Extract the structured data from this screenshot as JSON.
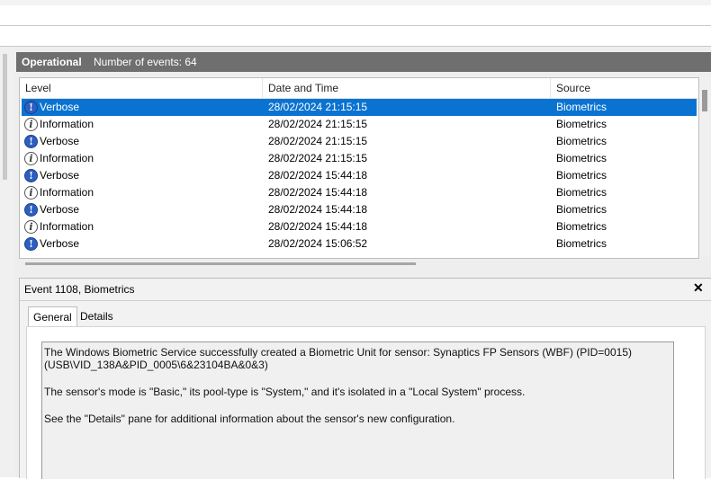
{
  "header": {
    "title": "Operational",
    "event_count": "Number of events: 64"
  },
  "columns": {
    "level": "Level",
    "datetime": "Date and Time",
    "source": "Source"
  },
  "events": [
    {
      "level": "Verbose",
      "icon": "verbose-icon",
      "datetime": "28/02/2024 21:15:15",
      "source": "Biometrics",
      "selected": true
    },
    {
      "level": "Information",
      "icon": "information-icon",
      "datetime": "28/02/2024 21:15:15",
      "source": "Biometrics"
    },
    {
      "level": "Verbose",
      "icon": "verbose-icon",
      "datetime": "28/02/2024 21:15:15",
      "source": "Biometrics"
    },
    {
      "level": "Information",
      "icon": "information-icon",
      "datetime": "28/02/2024 21:15:15",
      "source": "Biometrics"
    },
    {
      "level": "Verbose",
      "icon": "verbose-icon",
      "datetime": "28/02/2024 15:44:18",
      "source": "Biometrics"
    },
    {
      "level": "Information",
      "icon": "information-icon",
      "datetime": "28/02/2024 15:44:18",
      "source": "Biometrics"
    },
    {
      "level": "Verbose",
      "icon": "verbose-icon",
      "datetime": "28/02/2024 15:44:18",
      "source": "Biometrics"
    },
    {
      "level": "Information",
      "icon": "information-icon",
      "datetime": "28/02/2024 15:44:18",
      "source": "Biometrics"
    },
    {
      "level": "Verbose",
      "icon": "verbose-icon",
      "datetime": "28/02/2024 15:06:52",
      "source": "Biometrics"
    }
  ],
  "event_panel": {
    "title": "Event 1108, Biometrics",
    "close_glyph": "✕",
    "tabs": [
      "General",
      "Details"
    ],
    "description": [
      "The Windows Biometric Service successfully created a Biometric Unit for sensor: Synaptics FP Sensors (WBF) (PID=0015) (USB\\VID_138A&PID_0005\\6&23104BA&0&3)",
      "The sensor's mode is \"Basic,\" its pool-type is \"System,\" and it's isolated in a \"Local System\" process.",
      "See the \"Details\" pane for additional information about the sensor's new configuration."
    ]
  },
  "colors": {
    "selection": "#0a73d1",
    "header_bar": "#6f6f6f",
    "verbose_icon": "#2d5fc0"
  }
}
